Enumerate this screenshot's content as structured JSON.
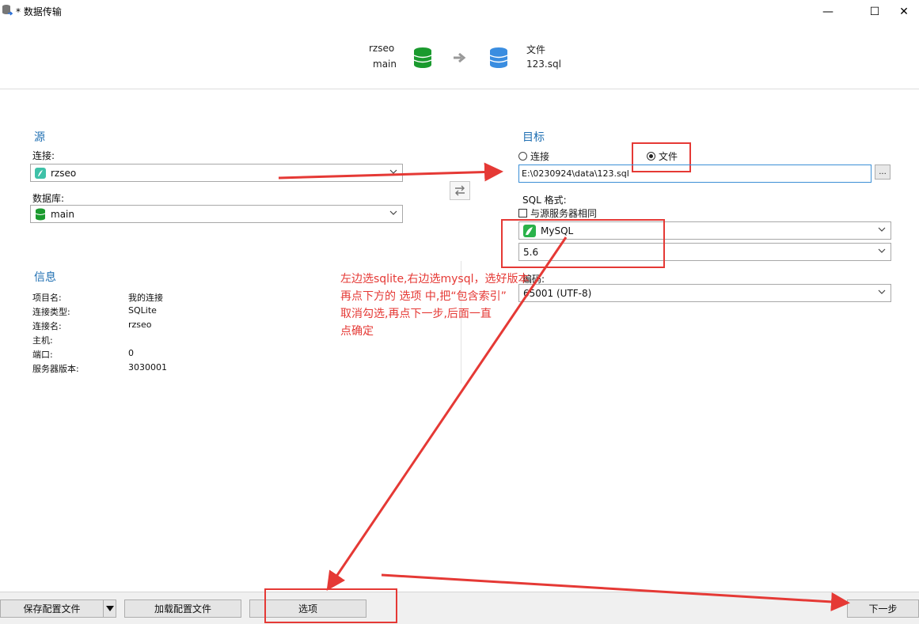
{
  "window": {
    "title": "* 数据传输",
    "minimize_glyph": "—",
    "maximize_glyph": "☐",
    "close_glyph": "✕"
  },
  "header": {
    "source_name": "rzseo",
    "source_db": "main",
    "target_type": "文件",
    "target_file": "123.sql"
  },
  "source": {
    "section_title": "源",
    "connection_label": "连接:",
    "connection_value": "rzseo",
    "database_label": "数据库:",
    "database_value": "main"
  },
  "info": {
    "section_title": "信息",
    "rows": [
      {
        "label": "项目名:",
        "value": "我的连接"
      },
      {
        "label": "连接类型:",
        "value": "SQLite"
      },
      {
        "label": "连接名:",
        "value": "rzseo"
      },
      {
        "label": "主机:",
        "value": ""
      },
      {
        "label": "端口:",
        "value": "0"
      },
      {
        "label": "服务器版本:",
        "value": "3030001"
      }
    ]
  },
  "target": {
    "section_title": "目标",
    "radio_connection": "连接",
    "radio_file": "文件",
    "selected": "文件",
    "file_path": "E:\\0230924\\data\\123.sql",
    "browse_label": "...",
    "sql_format_label": "SQL 格式:",
    "same_as_source_label": "与源服务器相同",
    "server_type": "MySQL",
    "server_version": "5.6",
    "encoding_label": "编码:",
    "encoding_value": "65001 (UTF-8)"
  },
  "annotation": {
    "lines": [
      "左边选sqlite,右边选mysql，选好版本",
      "再点下方的 选项 中,把“包含索引”",
      "取消勾选,再点下一步,后面一直",
      "点确定"
    ],
    "color": "#e53935"
  },
  "footer": {
    "save_config": "保存配置文件",
    "load_config": "加载配置文件",
    "options": "选项",
    "next": "下一步"
  },
  "colors": {
    "accent": "#1f6fb2",
    "source_db_icon": "#1a9a2e",
    "target_db_icon": "#3a8de0",
    "annotation_red": "#e53935"
  },
  "icons": [
    "app-icon",
    "database-icon",
    "arrow-right-icon",
    "sqlite-icon",
    "swap-icon",
    "mysql-icon",
    "chevron-down-icon",
    "dropdown-arrow-icon"
  ]
}
